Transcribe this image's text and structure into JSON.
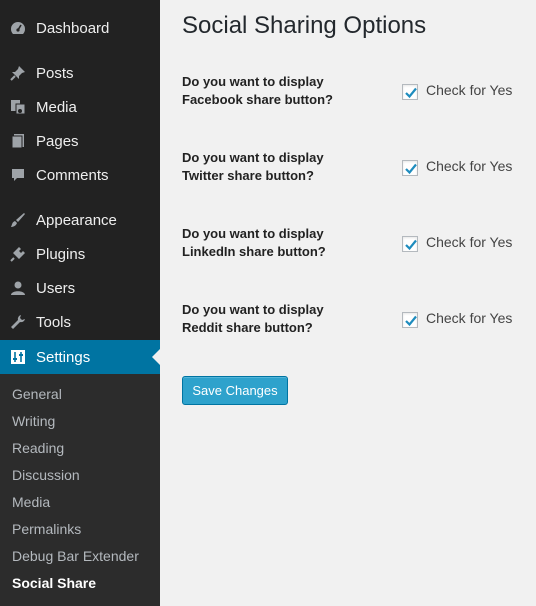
{
  "sidebar": {
    "items": [
      {
        "label": "Dashboard",
        "icon": "dashboard-icon"
      },
      {
        "label": "Posts",
        "icon": "pin-icon"
      },
      {
        "label": "Media",
        "icon": "media-icon"
      },
      {
        "label": "Pages",
        "icon": "pages-icon"
      },
      {
        "label": "Comments",
        "icon": "comments-icon"
      },
      {
        "label": "Appearance",
        "icon": "brush-icon"
      },
      {
        "label": "Plugins",
        "icon": "plugin-icon"
      },
      {
        "label": "Users",
        "icon": "user-icon"
      },
      {
        "label": "Tools",
        "icon": "wrench-icon"
      },
      {
        "label": "Settings",
        "icon": "settings-icon",
        "active": true
      }
    ],
    "submenu": [
      {
        "label": "General"
      },
      {
        "label": "Writing"
      },
      {
        "label": "Reading"
      },
      {
        "label": "Discussion"
      },
      {
        "label": "Media"
      },
      {
        "label": "Permalinks"
      },
      {
        "label": "Debug Bar Extender"
      },
      {
        "label": "Social Share",
        "current": true
      }
    ]
  },
  "main": {
    "title": "Social Sharing Options",
    "options": [
      {
        "line1": "Do you want to display",
        "line2": "Facebook share button?",
        "checked": true,
        "check_label": "Check for Yes"
      },
      {
        "line1": "Do you want to display",
        "line2": "Twitter share button?",
        "checked": true,
        "check_label": "Check for Yes"
      },
      {
        "line1": "Do you want to display",
        "line2": "LinkedIn share button?",
        "checked": true,
        "check_label": "Check for Yes"
      },
      {
        "line1": "Do you want to display",
        "line2": "Reddit share button?",
        "checked": true,
        "check_label": "Check for Yes"
      }
    ],
    "save_label": "Save Changes"
  },
  "colors": {
    "sidebar_bg": "#222222",
    "submenu_bg": "#2c2c2c",
    "active_bg": "#0074a2",
    "button_bg": "#2ea2cc",
    "checkmark": "#1e8cbe",
    "content_bg": "#f1f1f1"
  }
}
